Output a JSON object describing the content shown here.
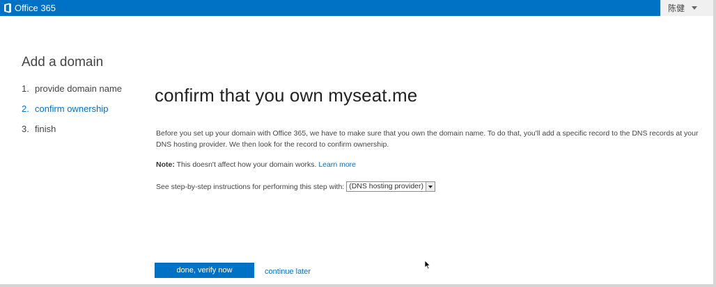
{
  "header": {
    "brand": "Office 365",
    "user_name": "陈健"
  },
  "nav": {
    "heading": "Add a domain",
    "steps": [
      {
        "number": "1.",
        "label": "provide domain name",
        "active": false
      },
      {
        "number": "2.",
        "label": "confirm ownership",
        "active": true
      },
      {
        "number": "3.",
        "label": "finish",
        "active": false
      }
    ]
  },
  "main": {
    "title": "confirm that you own myseat.me",
    "intro": "Before you set up your domain with Office 365, we have to make sure that you own the domain name. To do that, you'll add a specific record to the DNS records at your DNS hosting provider. We then look for the record to confirm ownership.",
    "note_label": "Note:",
    "note_text": " This doesn't affect how your domain works. ",
    "learn_more": "Learn more",
    "instructions_label": "See step-by-step instructions for performing this step with:",
    "provider_selected": "(DNS hosting provider)"
  },
  "actions": {
    "verify_label": "done, verify now",
    "later_label": "continue later"
  },
  "colors": {
    "accent": "#0072c6",
    "text": "#444444"
  },
  "icons": {
    "brand": "office-logo-icon",
    "user_menu": "chevron-down-icon",
    "select_arrow": "dropdown-arrow-icon",
    "pointer": "mouse-pointer-icon"
  }
}
